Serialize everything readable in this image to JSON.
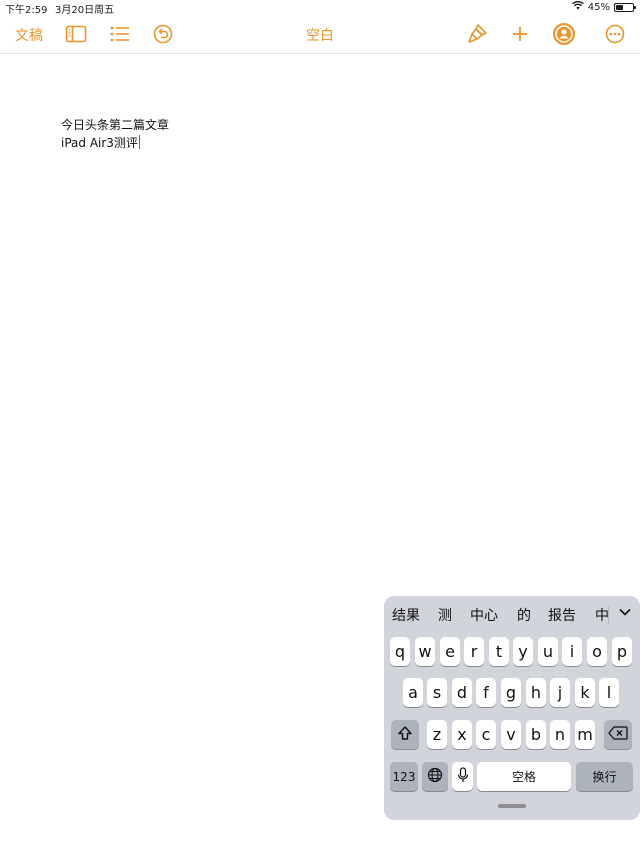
{
  "status_bar": {
    "time": "下午2:59",
    "date": "3月20日周五",
    "battery_percent": "45%",
    "battery_level": 0.45,
    "icons": [
      "wifi-icon",
      "battery-icon"
    ]
  },
  "toolbar": {
    "documents_label": "文稿",
    "title": "空白",
    "accent_color": "#e8962c",
    "left_icons": [
      "sidebar-icon",
      "list-icon",
      "undo-icon"
    ],
    "right_icons": [
      "paintbrush-icon",
      "plus-icon",
      "collaborate-icon",
      "more-icon"
    ]
  },
  "document": {
    "lines": [
      "今日头条第二篇文章",
      "iPad Air3测评"
    ]
  },
  "keyboard": {
    "candidates": [
      "结果",
      "测",
      "中心",
      "的",
      "报告",
      "中"
    ],
    "row1": [
      "q",
      "w",
      "e",
      "r",
      "t",
      "y",
      "u",
      "i",
      "o",
      "p"
    ],
    "row2": [
      "a",
      "s",
      "d",
      "f",
      "g",
      "h",
      "j",
      "k",
      "l"
    ],
    "row3": [
      "z",
      "x",
      "c",
      "v",
      "b",
      "n",
      "m"
    ],
    "numbers_key": "123",
    "space_key": "空格",
    "return_key": "换行",
    "icons": [
      "shift-icon",
      "delete-icon",
      "globe-icon",
      "microphone-icon",
      "chevron-down-icon"
    ]
  }
}
